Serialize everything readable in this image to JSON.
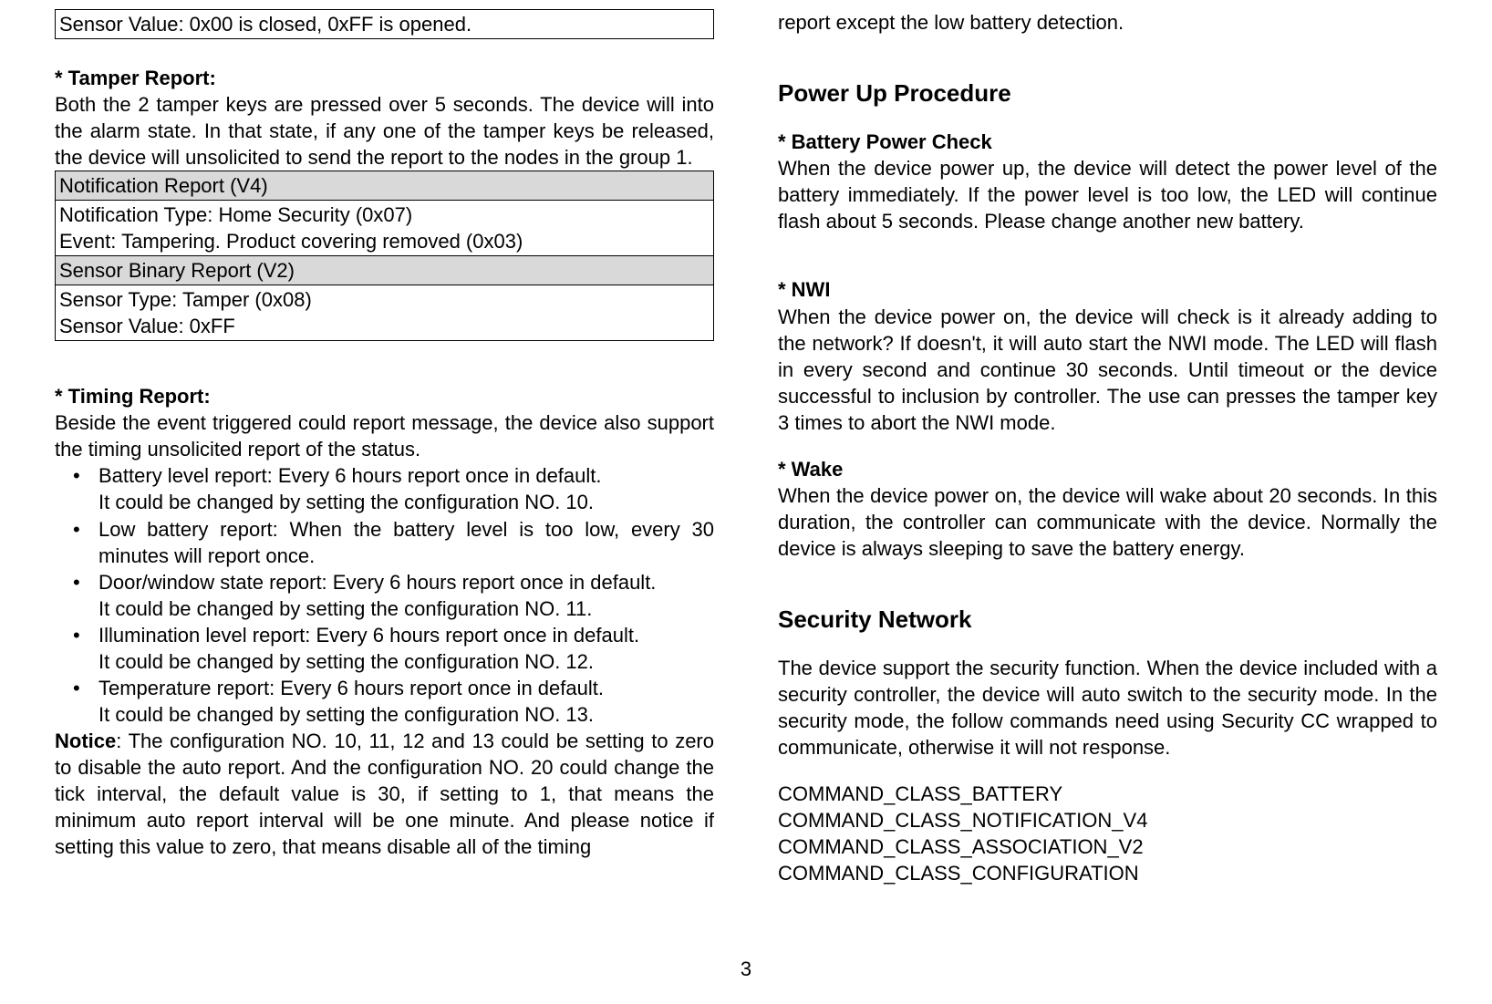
{
  "left": {
    "table1_cell": "Sensor Value: 0x00 is closed, 0xFF is opened.",
    "tamper_title": "* Tamper Report:",
    "tamper_body": "Both the 2 tamper keys are pressed over 5 seconds. The device will into the alarm state. In that state, if any one of the tamper keys be released, the device will unsolicited to send the report to the nodes in the group 1.",
    "t2_r1": "Notification Report (V4)",
    "t2_r2a": "Notification Type: Home Security (0x07)",
    "t2_r2b": "Event: Tampering. Product covering removed (0x03)",
    "t2_r3": "Sensor Binary Report (V2)",
    "t2_r4a": "Sensor Type: Tamper (0x08)",
    "t2_r4b": "Sensor Value: 0xFF",
    "timing_title": "* Timing Report:",
    "timing_body": "Beside the event triggered could report message, the device also support the timing unsolicited report of the status.",
    "bul1a": "Battery level report: Every 6 hours report once in default.",
    "bul1b": "It could be changed by setting the configuration NO. 10.",
    "bul2": "Low battery report: When the battery level is too low, every 30 minutes will report once.",
    "bul3a": "Door/window state report: Every 6 hours report once in default.",
    "bul3b": "It could be changed by setting the configuration NO. 11.",
    "bul4a": "Illumination level report: Every 6 hours report once in default.",
    "bul4b": "It could be changed by setting the configuration NO. 12.",
    "bul5a": "Temperature report: Every 6 hours report once in default.",
    "bul5b": "It could be changed by setting the configuration NO. 13.",
    "notice_label": "Notice",
    "notice_body": ":  The configuration NO. 10, 11, 12 and 13 could be setting to zero to disable the auto report. And the configuration NO. 20 could change the tick interval, the default value is 30, if setting to 1, that means the minimum auto report interval will be one minute. And please notice if setting this value to zero, that means disable all of the timing"
  },
  "right": {
    "cont": "report except the low battery detection.",
    "h_power": "Power Up Procedure",
    "batt_title": "* Battery Power Check",
    "batt_body": "When the device power up, the device will detect the power level of the battery immediately. If the power level is too low, the LED will continue flash about 5 seconds. Please change another new battery.",
    "nwi_title": "* NWI",
    "nwi_body": "When the device power on, the device will check is it already adding to the network? If doesn't, it will auto start the NWI mode. The LED will flash in every second and continue 30 seconds. Until timeout or the device successful to inclusion by controller. The use can presses the tamper key 3 times to abort the NWI mode.",
    "wake_title": "* Wake",
    "wake_body": "When the device power on, the device will wake about 20 seconds. In this duration, the controller can communicate with the device. Normally the device is always sleeping to save the battery energy.",
    "h_sec": "Security Network",
    "sec_body": "The device support the security function. When the device included with a security controller, the device will auto switch to the security mode. In the security mode, the follow commands need using Security CC wrapped to communicate, otherwise it will not response.",
    "cmd1": "COMMAND_CLASS_BATTERY",
    "cmd2": "COMMAND_CLASS_NOTIFICATION_V4",
    "cmd3": "COMMAND_CLASS_ASSOCIATION_V2",
    "cmd4": "COMMAND_CLASS_CONFIGURATION"
  },
  "page_number": "3"
}
